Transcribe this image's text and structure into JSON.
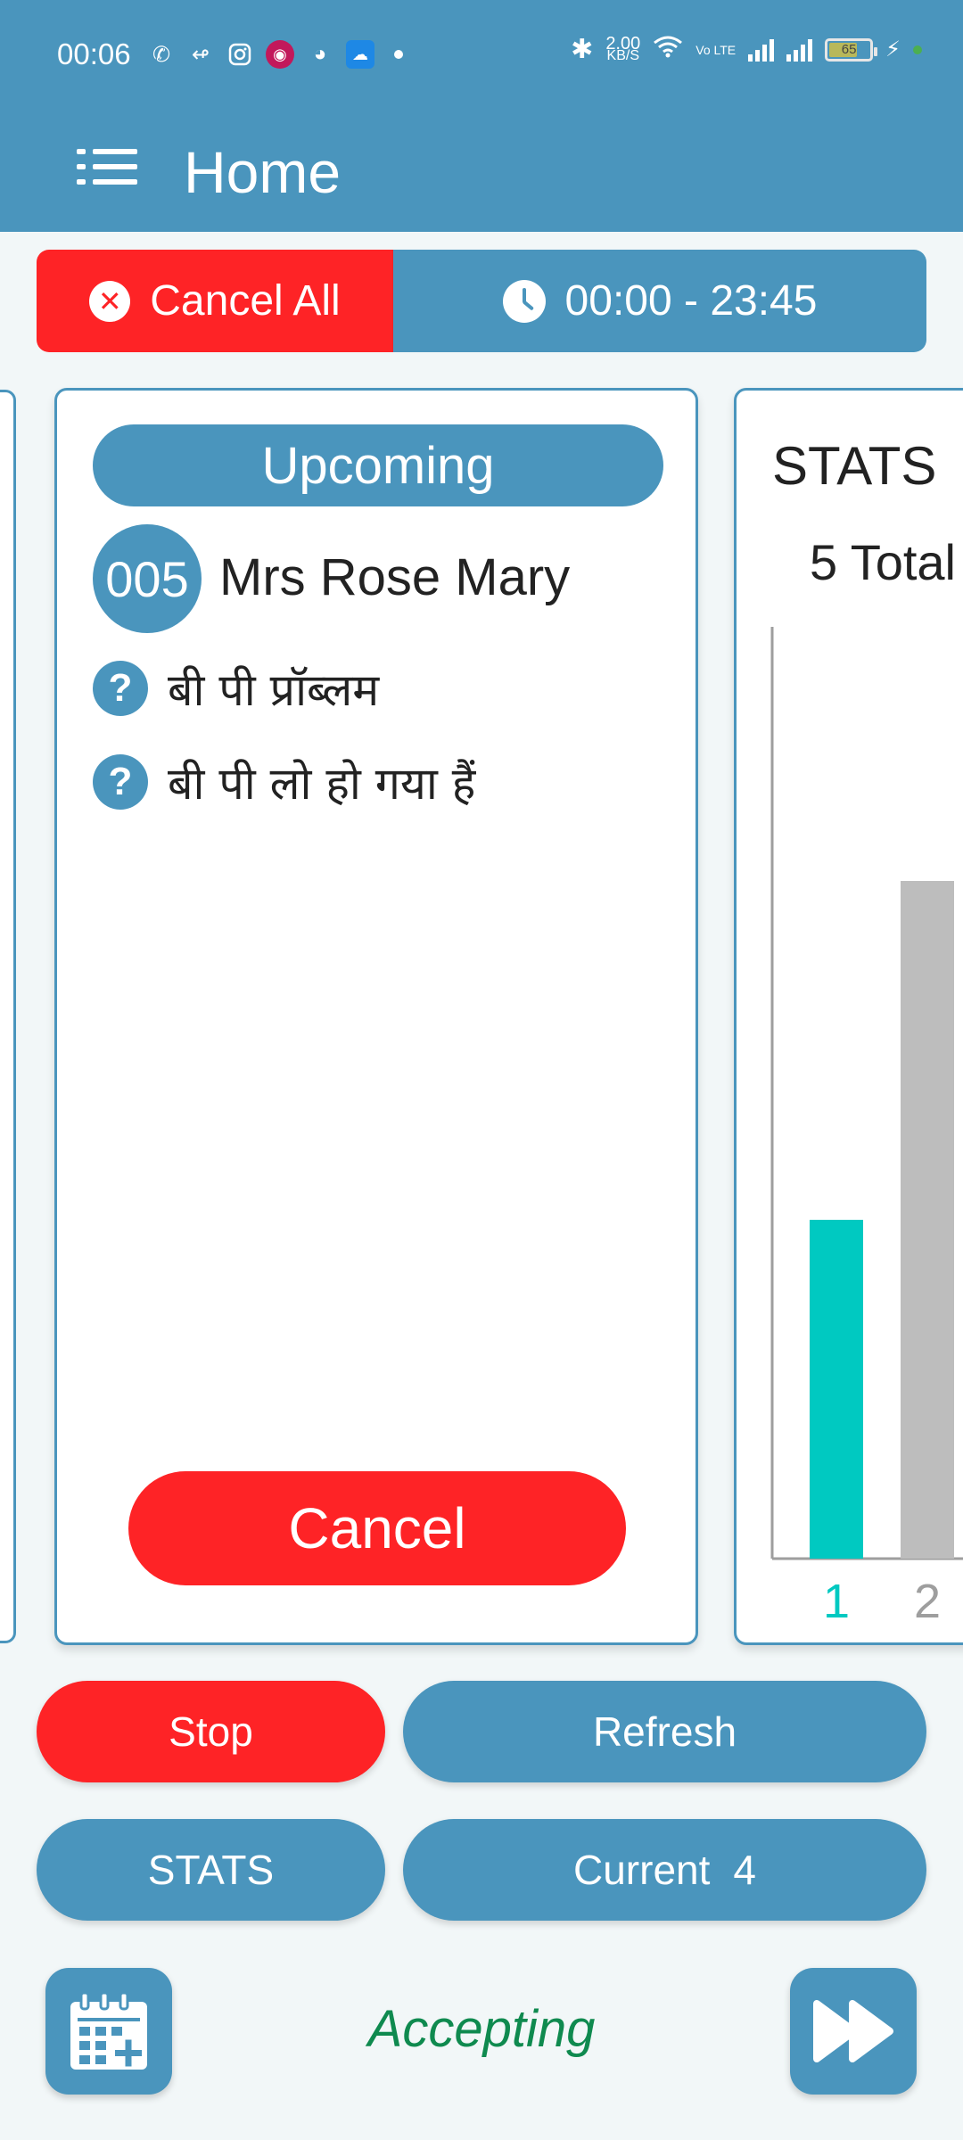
{
  "status_bar": {
    "time": "00:06",
    "net_speed_value": "2.00",
    "net_speed_unit": "KB/S",
    "volte": "Vo LTE",
    "battery_level": "65"
  },
  "app_bar": {
    "title": "Home",
    "menu_icon": "menu-list-icon"
  },
  "schedule_bar": {
    "cancel_all_label": "Cancel All",
    "time_range": "00:00 - 23:45"
  },
  "upcoming_card": {
    "header": "Upcoming",
    "token": "005",
    "patient_name": "Mrs Rose Mary",
    "complaints": [
      "बी पी प्रॉब्लम",
      "बी पी लो हो गया हैं"
    ],
    "cancel_label": "Cancel"
  },
  "stats_card": {
    "title": "STATS",
    "total_label": "5 Total",
    "chart_data": {
      "type": "bar",
      "categories": [
        "1",
        "2"
      ],
      "values": [
        1,
        2
      ],
      "colors": [
        "#00c9c1",
        "#bdbdbd"
      ],
      "ylim": [
        0,
        2.75
      ]
    }
  },
  "actions": {
    "stop_label": "Stop",
    "refresh_label": "Refresh",
    "stats_label": "STATS",
    "current_label": "Current",
    "current_count": "4"
  },
  "footer": {
    "status_text": "Accepting",
    "calendar_icon": "calendar-add-icon",
    "next_icon": "fast-forward-icon"
  },
  "colors": {
    "primary": "#4a95bd",
    "danger": "#fe2326",
    "accepting": "#0f8a4f"
  }
}
